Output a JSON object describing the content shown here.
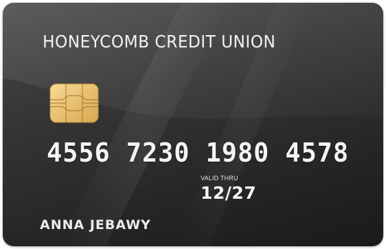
{
  "card": {
    "issuer": "HONEYCOMB CREDIT UNION",
    "number": "4556 7230 1980 4578",
    "valid_thru_label": "VALID THRU",
    "expiry": "12/27",
    "cardholder": "ANNA JEBAWY"
  },
  "colors": {
    "card_background": "#2e2e2e",
    "chip_gold": "#e9c477",
    "text": "#f2f2f2"
  },
  "icons": {
    "chip": "emv-chip-icon"
  }
}
